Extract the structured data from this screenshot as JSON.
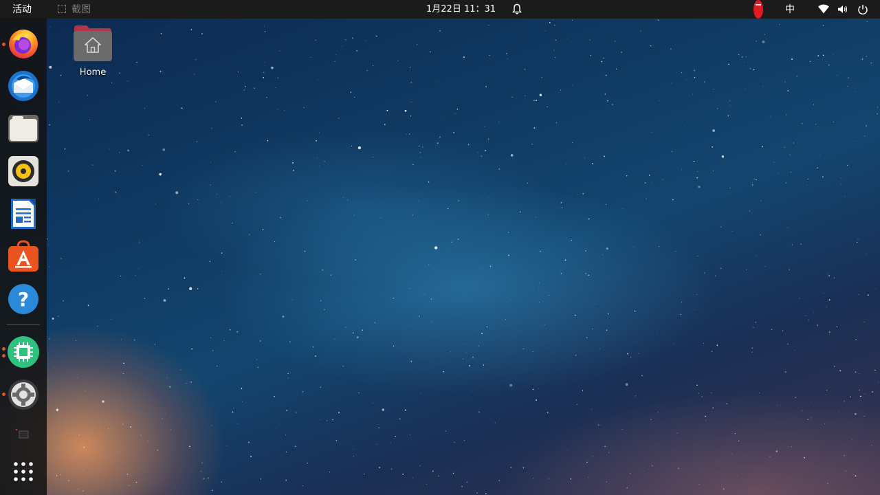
{
  "topbar": {
    "activities": "活动",
    "app_menu": "截图",
    "clock": "1月22日  11：31",
    "input_method": "中"
  },
  "dock": {
    "items": [
      {
        "name": "firefox",
        "running": true
      },
      {
        "name": "thunderbird",
        "running": false
      },
      {
        "name": "files",
        "running": false
      },
      {
        "name": "rhythmbox",
        "running": false
      },
      {
        "name": "libreoffice-writer",
        "running": false
      },
      {
        "name": "ubuntu-software",
        "running": false
      },
      {
        "name": "help",
        "running": false
      },
      {
        "name": "system-monitor",
        "running": true
      },
      {
        "name": "settings",
        "running": true
      },
      {
        "name": "terminal",
        "running": false
      },
      {
        "name": "show-applications",
        "running": false
      }
    ]
  },
  "desktop": {
    "home_label": "Home"
  },
  "colors": {
    "accent": "#e95420",
    "topbar": "#1b1b1b",
    "dnd": "#e01b24"
  }
}
